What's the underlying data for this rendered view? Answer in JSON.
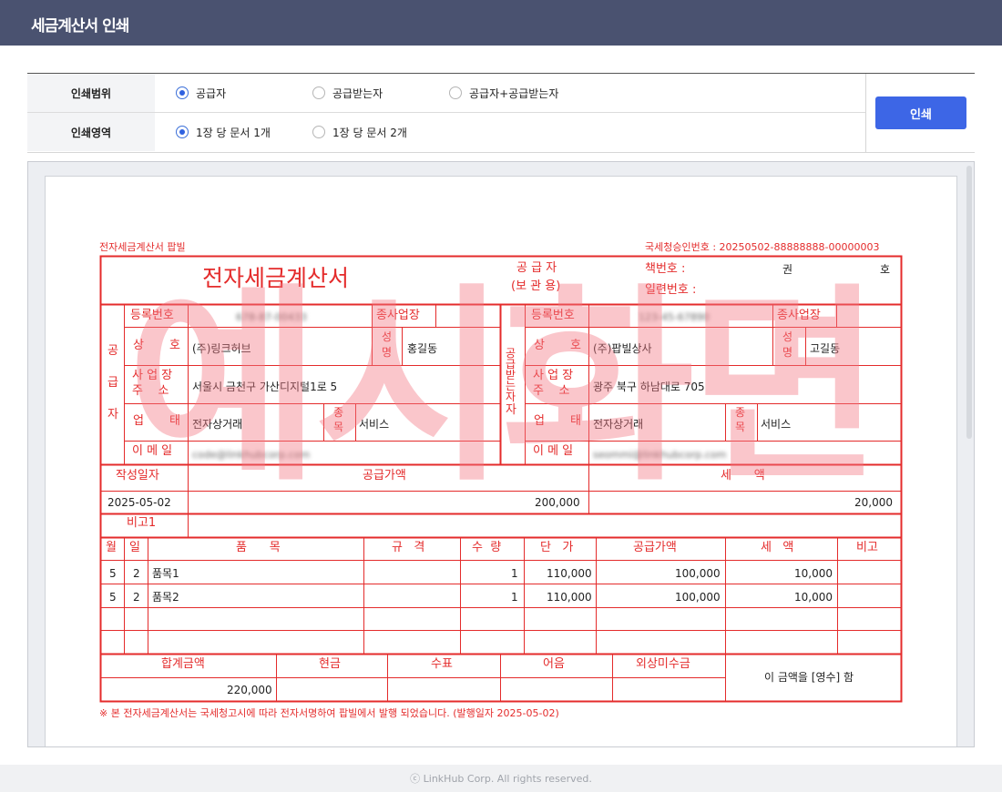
{
  "header": {
    "title": "세금계산서 인쇄"
  },
  "options": {
    "range": {
      "label": "인쇄범위",
      "choices": [
        {
          "label": "공급자",
          "checked": true
        },
        {
          "label": "공급받는자",
          "checked": false
        },
        {
          "label": "공급자+공급받는자",
          "checked": false
        }
      ]
    },
    "area": {
      "label": "인쇄영역",
      "choices": [
        {
          "label": "1장 당 문서 1개",
          "checked": true
        },
        {
          "label": "1장 당 문서 2개",
          "checked": false
        }
      ]
    },
    "print_button": "인쇄"
  },
  "invoice": {
    "top_left": "전자세금계산서 팝빌",
    "approval": "국세청승인번호 : 20250502-88888888-00000003",
    "title": "전자세금계산서",
    "supplier_copy_1": "공 급 자",
    "supplier_copy_2": "(보 관 용)",
    "book_label": "책번호 :",
    "book_vol": "권",
    "book_no": "호",
    "serial_label": "일련번호 :",
    "supplier_side": [
      "공",
      "급",
      "자"
    ],
    "buyer_side": "공급받는자",
    "reg_label": "등록번호",
    "branch_label": "종사업장",
    "name_label_1": "상",
    "name_label_2": "호",
    "ceo_label_1": "성",
    "ceo_label_2": "명",
    "addr_label_1": "사 업 장",
    "addr_label_2": "주    소",
    "biz_label_1": "업",
    "biz_label_2": "태",
    "item_label_1": "종",
    "item_label_2": "목",
    "email_label": "이 메 일",
    "supplier": {
      "reg_no": "678-87-00433",
      "company": "(주)링크허브",
      "ceo": "홍길동",
      "address": "서울시 금천구 가산디지털1로 5",
      "biz_type": "전자상거래",
      "biz_item": "서비스",
      "email": "code@linkhubcorp.com"
    },
    "buyer": {
      "reg_no": "123-45-67890",
      "company": "(주)팝빌상사",
      "ceo": "고길동",
      "address": "광주 북구 하남대로 705",
      "biz_type": "전자상거래",
      "biz_item": "서비스",
      "email": "seommi@linkhubcorp.com"
    },
    "write_date_label": "작성일자",
    "supply_amount_label": "공급가액",
    "tax_label": "세      액",
    "write_date": "2025-05-02",
    "supply_amount": "200,000",
    "tax_amount": "20,000",
    "remark_label": "비고1",
    "item_headers": {
      "month": "월",
      "day": "일",
      "name": "품      목",
      "spec": "규   격",
      "qty": "수  량",
      "price": "단   가",
      "supply": "공급가액",
      "tax": "세   액",
      "remark": "비고"
    },
    "items": [
      {
        "month": "5",
        "day": "2",
        "name": "품목1",
        "qty": "1",
        "price": "110,000",
        "supply": "100,000",
        "tax": "10,000"
      },
      {
        "month": "5",
        "day": "2",
        "name": "품목2",
        "qty": "1",
        "price": "110,000",
        "supply": "100,000",
        "tax": "10,000"
      }
    ],
    "total_label": "합계금액",
    "cash_label": "현금",
    "check_label": "수표",
    "note_label": "어음",
    "credit_label": "외상미수금",
    "total_amount": "220,000",
    "receipt_text": "이 금액을 [영수] 함",
    "footer_note": "※ 본 전자세금계산서는 국세청고시에 따라 전자서명하여 팝빌에서 발행 되었습니다. (발행일자 2025-05-02)",
    "watermark": "예시화면"
  },
  "footer": {
    "copyright": "ⓒ LinkHub Corp. All rights reserved."
  },
  "colors": {
    "header": "#4a5270",
    "accent": "#3d66e6",
    "invoice_red": "#e42b2b"
  }
}
